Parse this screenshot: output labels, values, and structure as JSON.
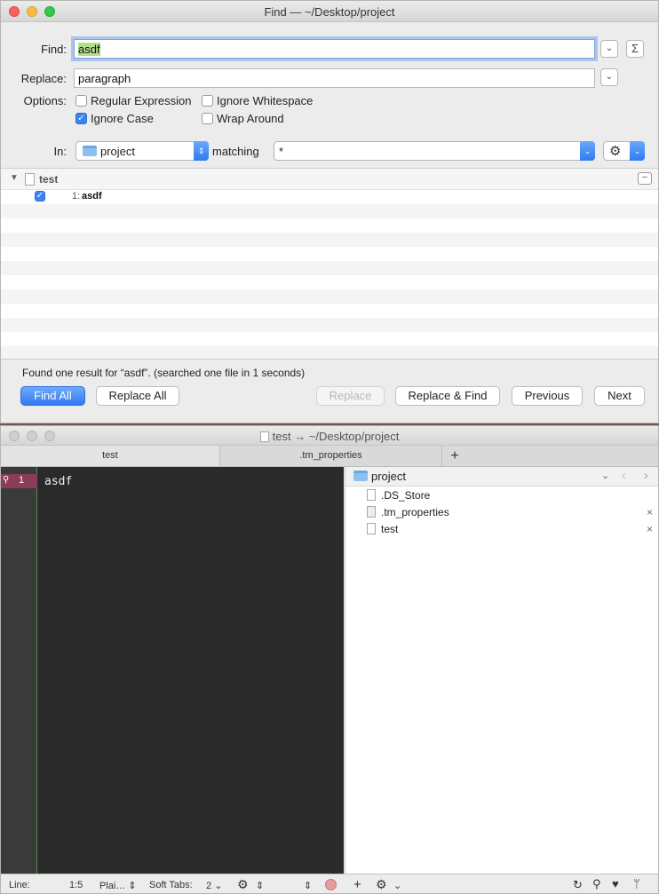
{
  "find_window": {
    "title": "Find — ~/Desktop/project",
    "find_label": "Find:",
    "find_value": "asdf",
    "replace_label": "Replace:",
    "replace_value": "paragraph",
    "sigma": "Σ",
    "options_label": "Options:",
    "options": {
      "regex": {
        "label": "Regular Expression",
        "checked": false
      },
      "ignore_whitespace": {
        "label": "Ignore Whitespace",
        "checked": false
      },
      "ignore_case": {
        "label": "Ignore Case",
        "checked": true
      },
      "wrap_around": {
        "label": "Wrap Around",
        "checked": false
      }
    },
    "in_label": "In:",
    "in_value": "project",
    "matching_label": "matching",
    "matching_value": "*",
    "results": {
      "file": "test",
      "match_line": "1:",
      "match_text": "asdf",
      "collapse": "−"
    },
    "status": "Found one result for “asdf”. (searched one file in 1 seconds)",
    "buttons": {
      "find_all": "Find All",
      "replace_all": "Replace All",
      "replace": "Replace",
      "replace_find": "Replace & Find",
      "previous": "Previous",
      "next": "Next"
    }
  },
  "editor_window": {
    "title": "test → ~/Desktop/project",
    "tabs": [
      "test",
      ".tm_properties"
    ],
    "add_tab": "+",
    "gutter_line": "1",
    "code_line": "asdf",
    "drawer": {
      "folder": "project",
      "items": [
        ".DS_Store",
        ".tm_properties",
        "test"
      ]
    },
    "statusbar": {
      "line_label": "Line:",
      "line_value": "1:5",
      "grammar": "Plai…",
      "soft_tabs_label": "Soft Tabs:",
      "soft_tabs_value": "2"
    }
  },
  "colors": {
    "accent": "#3179f1",
    "match_highlight": "#b3e08a",
    "editor_bg": "#2a2a2a",
    "search_marker": "#8a3c5a"
  }
}
